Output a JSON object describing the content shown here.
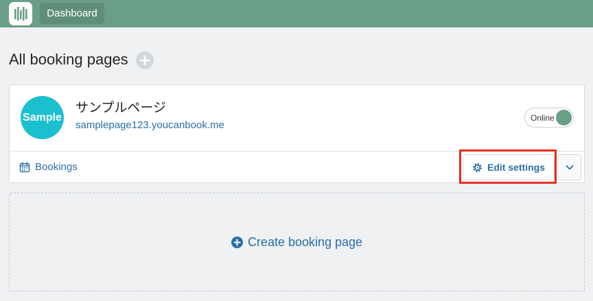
{
  "header": {
    "logo_icon": "bars-logo-icon",
    "dashboard_label": "Dashboard"
  },
  "page": {
    "title": "All booking pages",
    "add_icon": "plus-circle-icon"
  },
  "booking_page": {
    "avatar_text": "Sample",
    "name": "サンプルページ",
    "url": "samplepage123.youcanbook.me",
    "status_label": "Online",
    "status_on": true,
    "bookings_label": "Bookings",
    "bookings_icon": "calendar-icon",
    "edit_settings_label": "Edit settings",
    "edit_settings_icon": "gear-icon",
    "more_icon": "chevron-down-icon"
  },
  "create": {
    "label": "Create booking page",
    "icon": "plus-circle-icon"
  },
  "colors": {
    "header_bg": "#6a9e86",
    "accent": "#2b6ea6",
    "avatar_bg": "#1bc0cf",
    "status_on": "#6a9e86",
    "highlight": "#e52d1d"
  }
}
